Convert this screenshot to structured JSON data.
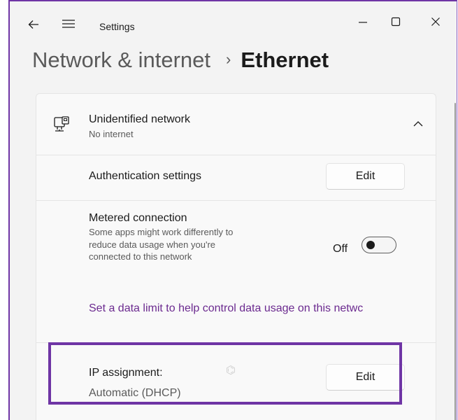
{
  "titlebar": {
    "app_title": "Settings",
    "back_icon": "back-arrow-icon",
    "menu_icon": "hamburger-menu-icon",
    "minimize_icon": "minimize-icon",
    "maximize_icon": "maximize-icon",
    "close_icon": "close-icon"
  },
  "breadcrumb": {
    "parent": "Network & internet",
    "separator": "›",
    "current": "Ethernet"
  },
  "network": {
    "icon": "ethernet-icon",
    "name": "Unidentified network",
    "status": "No internet",
    "chevron_icon": "chevron-up-icon"
  },
  "authentication": {
    "label": "Authentication settings",
    "button_label": "Edit"
  },
  "metered": {
    "label": "Metered connection",
    "description": "Some apps might work differently to reduce data usage when you're connected to this network",
    "toggle_state_label": "Off",
    "toggle_on": false,
    "data_limit_link": "Set a data limit to help control data usage on this netwc"
  },
  "ip_assignment": {
    "label": "IP assignment:",
    "value": "Automatic (DHCP)",
    "button_label": "Edit"
  },
  "colors": {
    "accent": "#6f35a5",
    "link": "#6b2a8f",
    "background": "#f3f3f3",
    "card": "#f9f9f9"
  }
}
